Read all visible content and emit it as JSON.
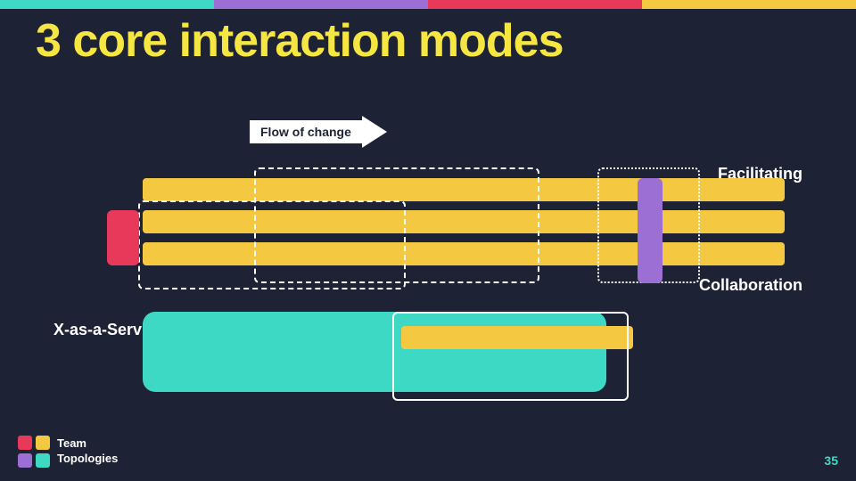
{
  "title": "3 core interaction modes",
  "topBar": {
    "colors": [
      "#3dd9c5",
      "#9b6fd4",
      "#e8395a",
      "#f5c842"
    ]
  },
  "diagram": {
    "flowOfChange": "Flow of change",
    "labels": {
      "facilitating": "Facilitating",
      "collaboration": "Collaboration",
      "xAsAService": "X-as-a-Service"
    }
  },
  "logo": {
    "name": "Team",
    "name2": "Topologies"
  },
  "slideNumber": "35"
}
